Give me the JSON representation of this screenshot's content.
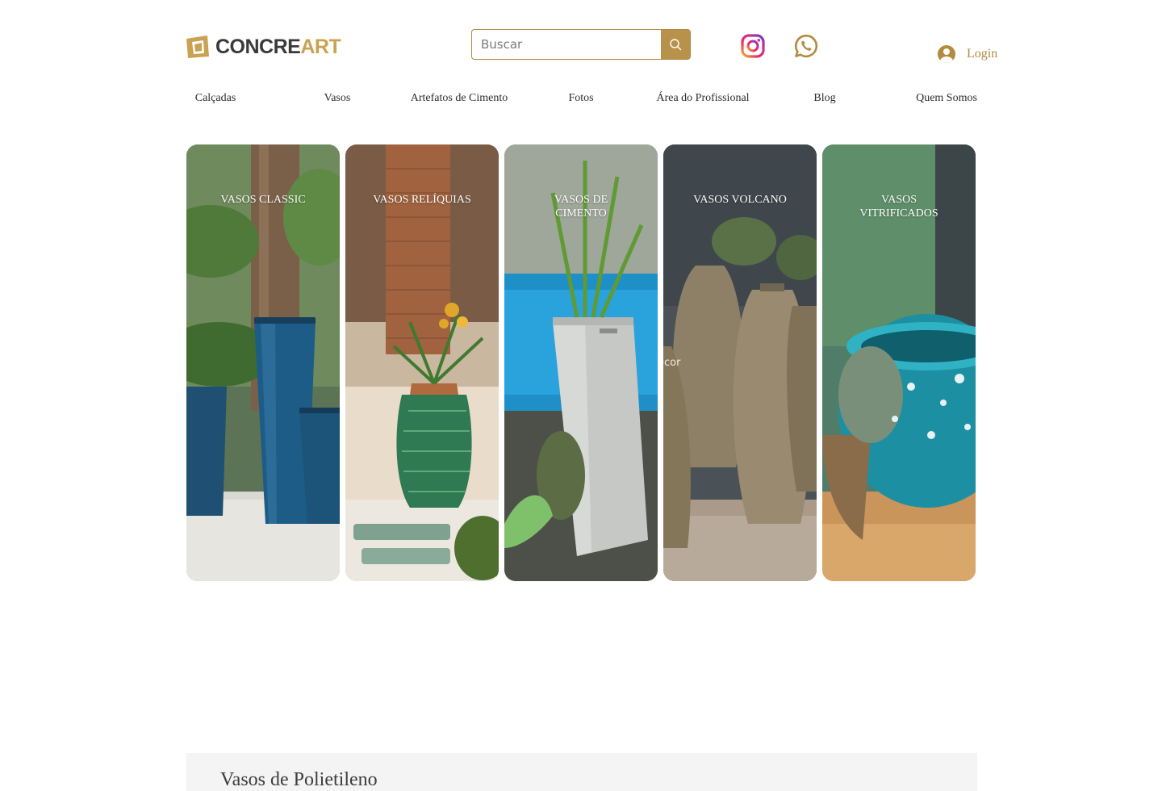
{
  "header": {
    "logo": {
      "text_dark": "CONCRE",
      "text_accent": "ART"
    },
    "search": {
      "placeholder": "Buscar"
    },
    "social": [
      {
        "name": "Instagram",
        "icon": "instagram-icon"
      },
      {
        "name": "WhatsApp",
        "icon": "whatsapp-icon"
      }
    ],
    "login": {
      "label": "Login",
      "icon": "user-avatar-icon"
    }
  },
  "nav": {
    "items": [
      {
        "label": "Calçadas"
      },
      {
        "label": "Vasos"
      },
      {
        "label": "Artefatos de Cimento"
      },
      {
        "label": "Fotos"
      },
      {
        "label": "Área do Profissional"
      },
      {
        "label": "Blog"
      },
      {
        "label": "Quem Somos"
      }
    ]
  },
  "categories": [
    {
      "title": "VASOS CLASSIC"
    },
    {
      "title": "VASOS RELÍQUIAS"
    },
    {
      "title": "VASOS DE CIMENTO"
    },
    {
      "title": "VASOS VOLCANO"
    },
    {
      "title": "VASOS VITRIFICADOS"
    }
  ],
  "watermark": "ecor",
  "section": {
    "title": "Vasos de Polietileno"
  },
  "colors": {
    "brand_gold": "#c9a252",
    "brand_dark": "#3a3a3a",
    "search_button": "#b8924a",
    "login_text": "#b08a3e",
    "section_bg": "#f4f4f4"
  }
}
